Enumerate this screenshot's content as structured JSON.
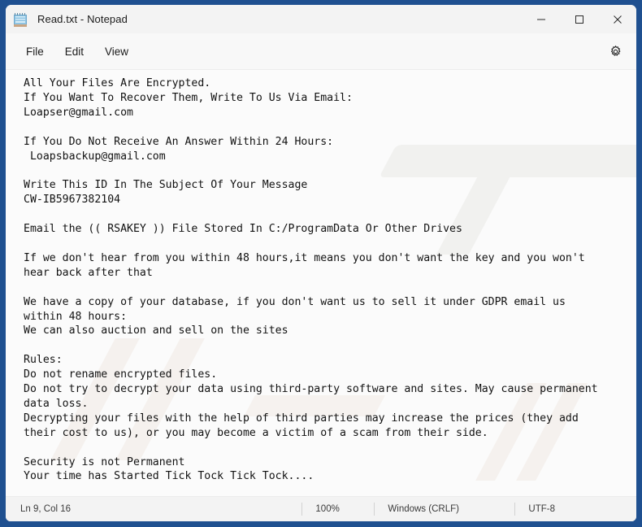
{
  "window": {
    "title": "Read.txt - Notepad",
    "icon": "notepad-icon",
    "border_color": "#1f5090",
    "controls": {
      "minimize": "Minimize",
      "maximize": "Maximize",
      "close": "Close"
    }
  },
  "menubar": {
    "items": [
      {
        "label": "File"
      },
      {
        "label": "Edit"
      },
      {
        "label": "View"
      }
    ],
    "settings_icon": "gear-icon"
  },
  "document": {
    "content": "All Your Files Are Encrypted.\nIf You Want To Recover Them, Write To Us Via Email:\nLoapser@gmail.com\n\nIf You Do Not Receive An Answer Within 24 Hours:\n Loapsbackup@gmail.com\n\nWrite This ID In The Subject Of Your Message\nCW-IB5967382104\n\nEmail the (( RSAKEY )) File Stored In C:/ProgramData Or Other Drives\n\nIf we don't hear from you within 48 hours,it means you don't want the key and you won't\nhear back after that\n\nWe have a copy of your database, if you don't want us to sell it under GDPR email us\nwithin 48 hours:\nWe can also auction and sell on the sites\n\nRules:\nDo not rename encrypted files.\nDo not try to decrypt your data using third-party software and sites. May cause permanent\ndata loss.\nDecrypting your files with the help of third parties may increase the prices (they add\ntheir cost to us), or you may become a victim of a scam from their side.\n\nSecurity is not Permanent\nYour time has Started Tick Tock Tick Tock....",
    "emails": [
      "Loapser@gmail.com",
      "Loapsbackup@gmail.com"
    ],
    "victim_id": "CW-IB5967382104",
    "key_file_path": "C:/ProgramData"
  },
  "statusbar": {
    "position": "Ln 9, Col 16",
    "zoom": "100%",
    "line_ending": "Windows (CRLF)",
    "encoding": "UTF-8"
  }
}
